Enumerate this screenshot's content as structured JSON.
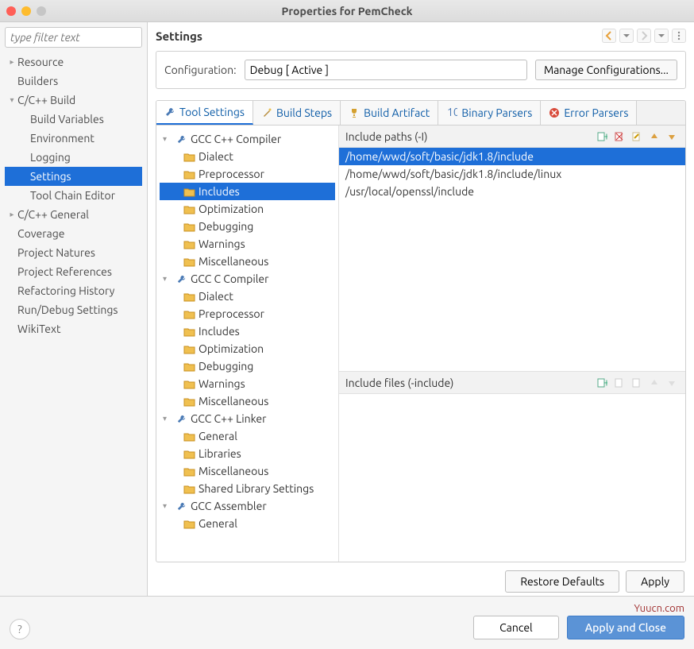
{
  "window": {
    "title": "Properties for PemCheck"
  },
  "sidebar": {
    "filter_placeholder": "type filter text",
    "items": [
      {
        "label": "Resource",
        "arrow": "▸"
      },
      {
        "label": "Builders"
      },
      {
        "label": "C/C++ Build",
        "arrow": "▾",
        "children": [
          {
            "label": "Build Variables"
          },
          {
            "label": "Environment"
          },
          {
            "label": "Logging"
          },
          {
            "label": "Settings",
            "selected": true
          },
          {
            "label": "Tool Chain Editor"
          }
        ]
      },
      {
        "label": "C/C++ General",
        "arrow": "▸"
      },
      {
        "label": "Coverage"
      },
      {
        "label": "Project Natures"
      },
      {
        "label": "Project References"
      },
      {
        "label": "Refactoring History"
      },
      {
        "label": "Run/Debug Settings"
      },
      {
        "label": "WikiText"
      }
    ]
  },
  "content": {
    "title": "Settings",
    "config_label": "Configuration:",
    "config_value": "Debug  [ Active ]",
    "manage_label": "Manage Configurations..."
  },
  "tabs": [
    {
      "label": "Tool Settings",
      "active": true,
      "icon": "wrench"
    },
    {
      "label": "Build Steps",
      "icon": "wand"
    },
    {
      "label": "Build Artifact",
      "icon": "trophy"
    },
    {
      "label": "Binary Parsers",
      "icon": "binary"
    },
    {
      "label": "Error Parsers",
      "icon": "error"
    }
  ],
  "tool_tree": [
    {
      "label": "GCC C++ Compiler",
      "arrow": "▾",
      "icon": "wrench",
      "children": [
        {
          "label": "Dialect",
          "icon": "folder"
        },
        {
          "label": "Preprocessor",
          "icon": "folder"
        },
        {
          "label": "Includes",
          "icon": "folder",
          "selected": true
        },
        {
          "label": "Optimization",
          "icon": "folder"
        },
        {
          "label": "Debugging",
          "icon": "folder"
        },
        {
          "label": "Warnings",
          "icon": "folder"
        },
        {
          "label": "Miscellaneous",
          "icon": "folder"
        }
      ]
    },
    {
      "label": "GCC C Compiler",
      "arrow": "▾",
      "icon": "wrench",
      "children": [
        {
          "label": "Dialect",
          "icon": "folder"
        },
        {
          "label": "Preprocessor",
          "icon": "folder"
        },
        {
          "label": "Includes",
          "icon": "folder"
        },
        {
          "label": "Optimization",
          "icon": "folder"
        },
        {
          "label": "Debugging",
          "icon": "folder"
        },
        {
          "label": "Warnings",
          "icon": "folder"
        },
        {
          "label": "Miscellaneous",
          "icon": "folder"
        }
      ]
    },
    {
      "label": "GCC C++ Linker",
      "arrow": "▾",
      "icon": "wrench",
      "children": [
        {
          "label": "General",
          "icon": "folder"
        },
        {
          "label": "Libraries",
          "icon": "folder"
        },
        {
          "label": "Miscellaneous",
          "icon": "folder"
        },
        {
          "label": "Shared Library Settings",
          "icon": "folder"
        }
      ]
    },
    {
      "label": "GCC Assembler",
      "arrow": "▾",
      "icon": "wrench",
      "children": [
        {
          "label": "General",
          "icon": "folder"
        }
      ]
    }
  ],
  "include_paths": {
    "title": "Include paths (-I)",
    "items": [
      {
        "path": "/home/wwd/soft/basic/jdk1.8/include",
        "selected": true
      },
      {
        "path": "/home/wwd/soft/basic/jdk1.8/include/linux"
      },
      {
        "path": "/usr/local/openssl/include"
      }
    ]
  },
  "include_files": {
    "title": "Include files (-include)"
  },
  "buttons": {
    "restore": "Restore Defaults",
    "apply": "Apply",
    "cancel": "Cancel",
    "apply_close": "Apply and Close"
  },
  "watermark": "Yuucn.com"
}
